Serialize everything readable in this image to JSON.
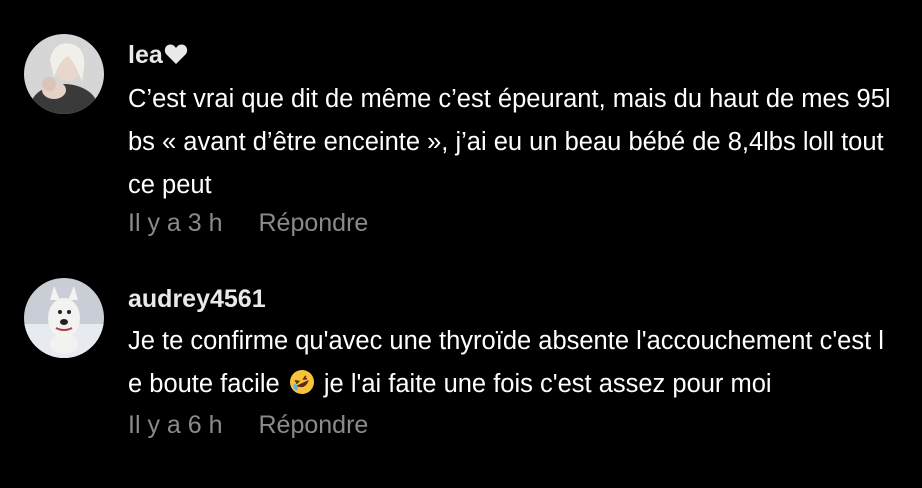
{
  "comments": [
    {
      "username": "lea",
      "username_suffix_icon": "white-heart-icon",
      "avatar_icon": "user-avatar-photo",
      "text": "C’est vrai que dit de même c’est épeurant, mais du haut de mes 95lbs « avant d’être enceinte », j’ai eu un beau bébé de 8,4lbs loll tout ce peut",
      "time": "Il y a 3 h",
      "reply_label": "Répondre"
    },
    {
      "username": "audrey4561",
      "avatar_icon": "dog-avatar-photo",
      "text_before_emoji": "Je te confirme qu'avec une thyroïde absente l'accouchement c'est le boute facile",
      "emoji": "rolling-on-floor-laughing-emoji",
      "text_after_emoji": "je l'ai faite une fois c'est assez pour moi",
      "time": "Il y a 6 h",
      "reply_label": "Répondre"
    }
  ],
  "colors": {
    "background": "#000000",
    "text": "#ffffff",
    "meta": "#8a8a8a"
  }
}
